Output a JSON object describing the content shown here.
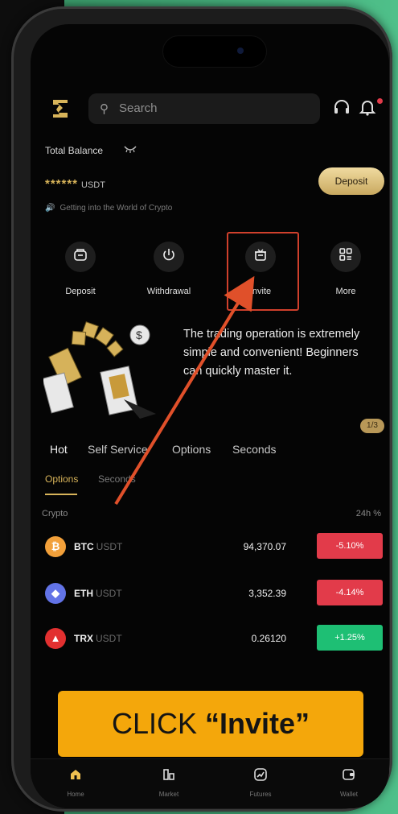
{
  "header": {
    "search_placeholder": "Search",
    "icons": [
      "logo-icon",
      "search-icon",
      "headset-icon",
      "bell-icon"
    ]
  },
  "balance": {
    "label": "Total Balance",
    "amount": "******",
    "currency": "USDT",
    "deposit_label": "Deposit",
    "notice": "Getting into the World of Crypto"
  },
  "actions": [
    {
      "label": "Deposit",
      "icon": "wallet-icon"
    },
    {
      "label": "Withdrawal",
      "icon": "withdraw-icon"
    },
    {
      "label": "Invite",
      "icon": "gift-icon"
    },
    {
      "label": "More",
      "icon": "grid-icon"
    }
  ],
  "promo": {
    "text": "The trading operation is extremely simple and convenient! Beginners can quickly master it.",
    "page": "1/3"
  },
  "tabs": [
    "Hot",
    "Self Service",
    "Options",
    "Seconds"
  ],
  "subtabs": [
    "Options",
    "Seconds"
  ],
  "list_header": {
    "left": "Crypto",
    "right": "24h %"
  },
  "market": [
    {
      "symbol": "BTC",
      "quote": "USDT",
      "price": "94,370.07",
      "change": "-5.10%",
      "dir": "neg",
      "color": "#f2a03a"
    },
    {
      "symbol": "ETH",
      "quote": "USDT",
      "price": "3,352.39",
      "change": "-4.14%",
      "dir": "neg",
      "color": "#6273e6"
    },
    {
      "symbol": "TRX",
      "quote": "USDT",
      "price": "0.26120",
      "change": "+1.25%",
      "dir": "pos",
      "color": "#e23030"
    }
  ],
  "cta": {
    "prefix": "CLICK",
    "emph": "“Invite”"
  },
  "bottom_nav": [
    {
      "label": "Home",
      "icon": "home-icon"
    },
    {
      "label": "Market",
      "icon": "market-icon"
    },
    {
      "label": "Futures",
      "icon": "futures-icon"
    },
    {
      "label": "Wallet",
      "icon": "wallet-icon"
    }
  ],
  "colors": {
    "accent": "#d8b45a",
    "negative": "#e23b4a",
    "positive": "#1ebf74",
    "cta": "#f4a70b",
    "highlight": "#d0402c"
  }
}
